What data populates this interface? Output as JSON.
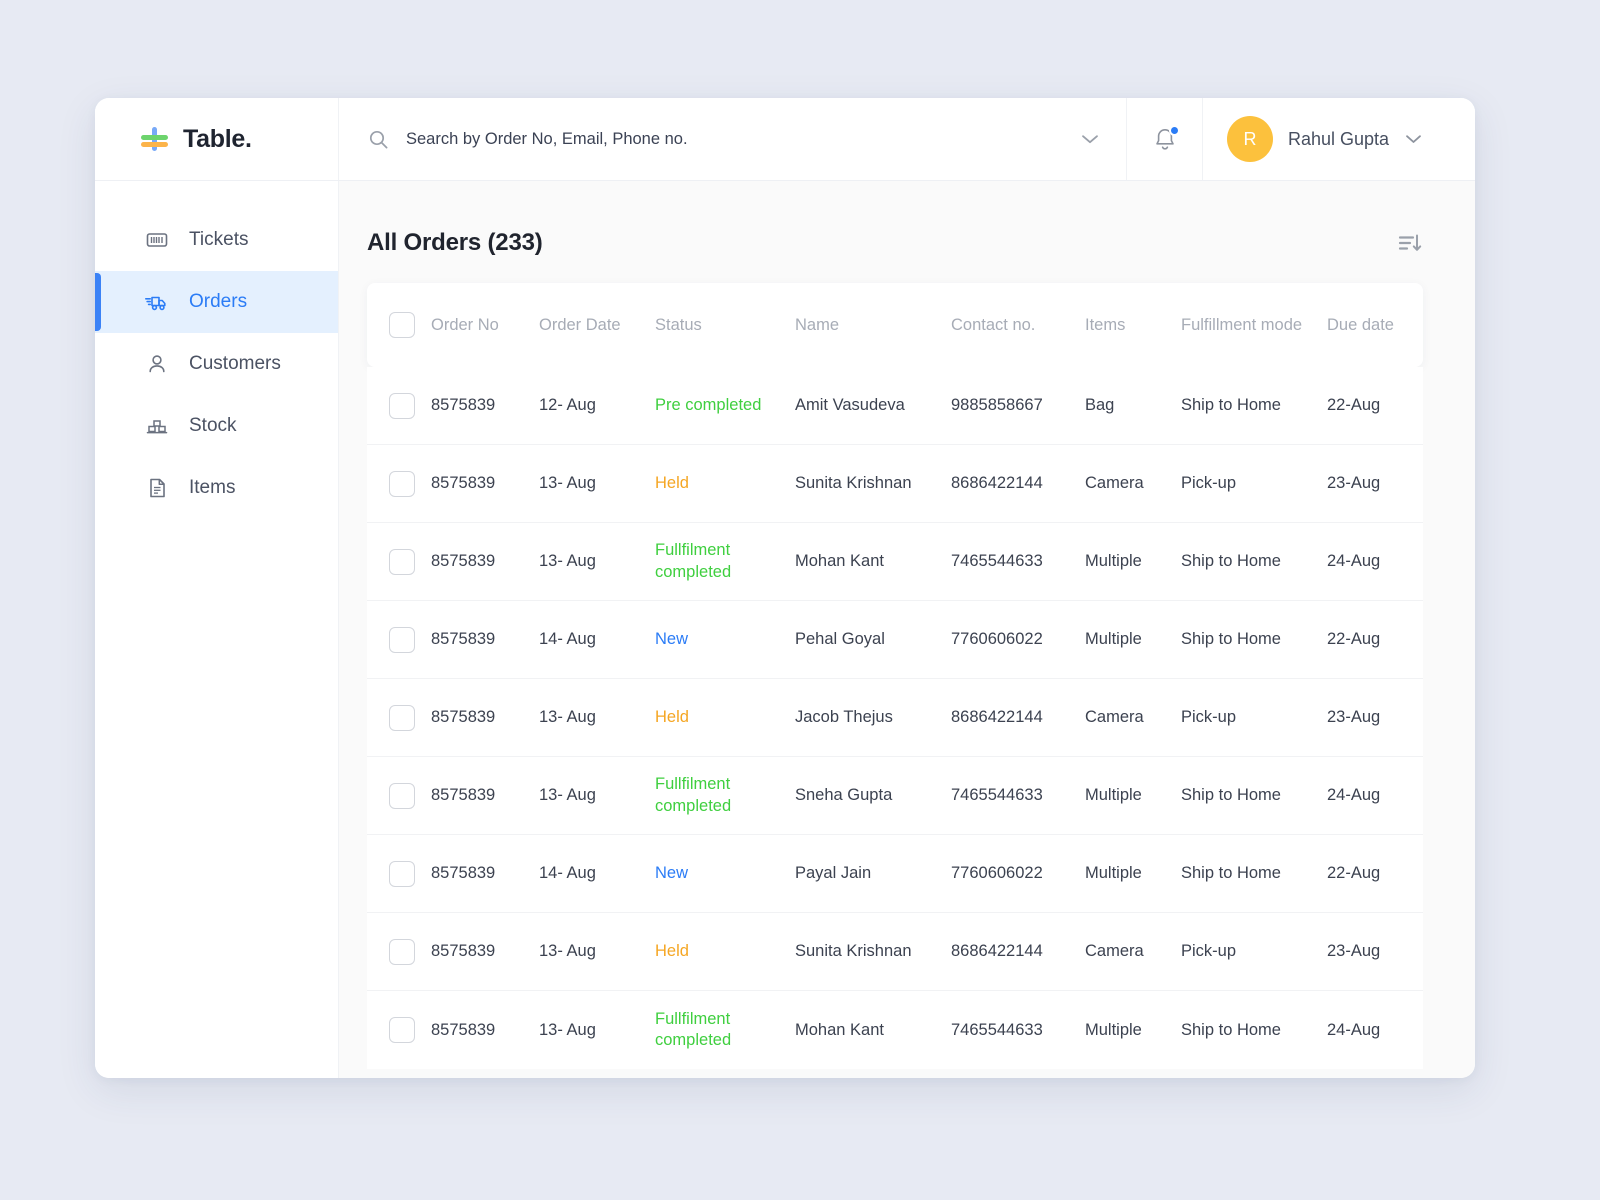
{
  "brand": {
    "name": "Table."
  },
  "search": {
    "placeholder": "Search by Order No, Email, Phone no.",
    "value": ""
  },
  "profile": {
    "initial": "R",
    "name": "Rahul Gupta"
  },
  "sidebar": {
    "items": [
      {
        "label": "Tickets",
        "icon": "ticket-icon",
        "active": false
      },
      {
        "label": "Orders",
        "icon": "truck-icon",
        "active": true
      },
      {
        "label": "Customers",
        "icon": "person-icon",
        "active": false
      },
      {
        "label": "Stock",
        "icon": "boxes-icon",
        "active": false
      },
      {
        "label": "Items",
        "icon": "document-icon",
        "active": false
      }
    ]
  },
  "main": {
    "title": "All Orders (233)",
    "order_count": 233,
    "sort_icon": "sort-descending-icon"
  },
  "table": {
    "columns": [
      "Order No",
      "Order Date",
      "Status",
      "Name",
      "Contact no.",
      "Items",
      "Fulfillment mode",
      "Due date"
    ],
    "rows": [
      {
        "order_no": "8575839",
        "order_date": "12- Aug",
        "status": "Pre completed",
        "status_color": "#3fcf3f",
        "name": "Amit Vasudeva",
        "contact": "9885858667",
        "items": "Bag",
        "fulfillment": "Ship to Home",
        "due_date": "22-Aug"
      },
      {
        "order_no": "8575839",
        "order_date": "13- Aug",
        "status": "Held",
        "status_color": "#f5a623",
        "name": "Sunita Krishnan",
        "contact": "8686422144",
        "items": "Camera",
        "fulfillment": "Pick-up",
        "due_date": "23-Aug"
      },
      {
        "order_no": "8575839",
        "order_date": "13- Aug",
        "status": "Fullfilment completed",
        "status_color": "#3fcf3f",
        "name": "Mohan Kant",
        "contact": "7465544633",
        "items": "Multiple",
        "fulfillment": "Ship to Home",
        "due_date": "24-Aug"
      },
      {
        "order_no": "8575839",
        "order_date": "14- Aug",
        "status": "New",
        "status_color": "#2b7cf6",
        "name": "Pehal Goyal",
        "contact": "7760606022",
        "items": "Multiple",
        "fulfillment": "Ship to Home",
        "due_date": "22-Aug"
      },
      {
        "order_no": "8575839",
        "order_date": "13- Aug",
        "status": "Held",
        "status_color": "#f5a623",
        "name": "Jacob Thejus",
        "contact": "8686422144",
        "items": "Camera",
        "fulfillment": "Pick-up",
        "due_date": "23-Aug"
      },
      {
        "order_no": "8575839",
        "order_date": "13- Aug",
        "status": "Fullfilment completed",
        "status_color": "#3fcf3f",
        "name": "Sneha Gupta",
        "contact": "7465544633",
        "items": "Multiple",
        "fulfillment": "Ship to Home",
        "due_date": "24-Aug"
      },
      {
        "order_no": "8575839",
        "order_date": "14- Aug",
        "status": "New",
        "status_color": "#2b7cf6",
        "name": "Payal Jain",
        "contact": "7760606022",
        "items": "Multiple",
        "fulfillment": "Ship to Home",
        "due_date": "22-Aug"
      },
      {
        "order_no": "8575839",
        "order_date": "13- Aug",
        "status": "Held",
        "status_color": "#f5a623",
        "name": "Sunita Krishnan",
        "contact": "8686422144",
        "items": "Camera",
        "fulfillment": "Pick-up",
        "due_date": "23-Aug"
      },
      {
        "order_no": "8575839",
        "order_date": "13- Aug",
        "status": "Fullfilment completed",
        "status_color": "#3fcf3f",
        "name": "Mohan Kant",
        "contact": "7465544633",
        "items": "Multiple",
        "fulfillment": "Ship to Home",
        "due_date": "24-Aug"
      }
    ]
  },
  "colors": {
    "accent_blue": "#2b7cf6",
    "status_green": "#3fcf3f",
    "status_orange": "#f5a623",
    "status_blue": "#2b7cf6",
    "avatar_orange": "#fcc13d",
    "page_background": "#e7eaf3"
  }
}
